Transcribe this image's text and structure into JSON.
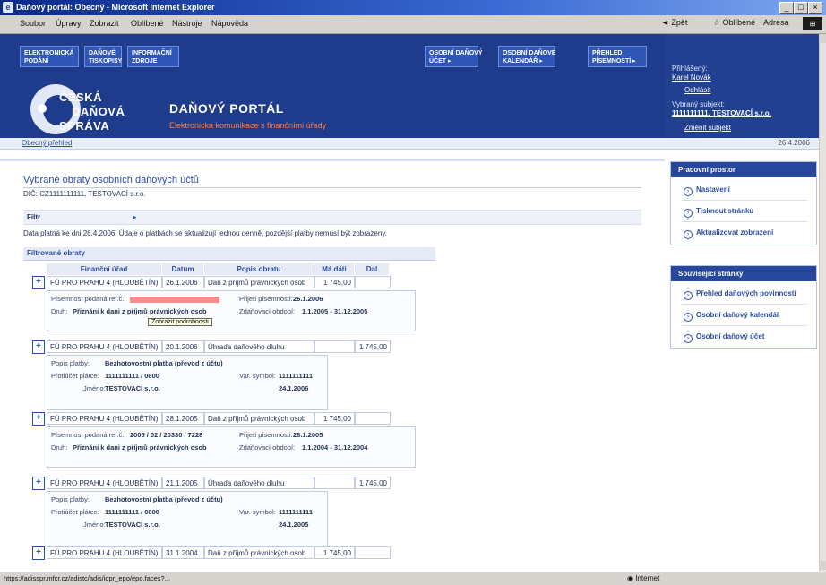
{
  "window": {
    "title": "Daňový portál: Obecný - Microsoft Internet Explorer",
    "controls": [
      "_",
      "□",
      "×"
    ]
  },
  "menubar": {
    "items": [
      "Soubor",
      "Úpravy",
      "Zobrazit",
      "Oblíbené",
      "Nástroje",
      "Nápověda"
    ],
    "toolbar_back": "Zpět",
    "toolbar_fav": "Oblíbené",
    "toolbar_address": "Adresa"
  },
  "header": {
    "top_buttons_left": [
      {
        "line1": "ELEKTRONICKÁ",
        "line2": "PODÁNÍ"
      },
      {
        "line1": "DAŇOVÉ",
        "line2": "TISKOPISY"
      },
      {
        "line1": "INFORMAČNÍ",
        "line2": "ZDROJE"
      }
    ],
    "top_buttons_right": [
      {
        "line1": "OSOBNÍ DAŇOVÝ",
        "line2": "ÚČET ▸"
      },
      {
        "line1": "OSOBNÍ DAŇOVÉ",
        "line2": "KALENDÁŘ ▸"
      },
      {
        "line1": "PŘEHLED",
        "line2": "PÍSEMNOSTÍ ▸"
      }
    ],
    "logo_lines": [
      "ČESKÁ",
      "DAŇOVÁ",
      "SPRÁVA"
    ],
    "portal_title": "DAŇOVÝ PORTÁL",
    "portal_subtitle": "Elektronická komunikace s finančními úřady",
    "right": {
      "user_label": "Přihlášený:",
      "user_name": "Karel Novák",
      "logout": "Odhlásit",
      "subject_label": "Vybraný subjekt:",
      "subject_value": "1111111111, TESTOVACÍ s.r.o.",
      "change": "Změnit subjekt"
    }
  },
  "subbar": {
    "link": "Obecný přehled",
    "date": "26.4.2006"
  },
  "main": {
    "title": "Vybrané obraty osobních daňových účtů",
    "dic": "DIČ: CZ1111111111, TESTOVACÍ s.r.o.",
    "filter_label": "Filtr",
    "filter_arrow": "▸",
    "data_line": "Data platná ke dni 26.4.2006. Údaje o platbách se aktualizují jednou denně, pozdější platby nemusí být zobrazeny.",
    "section_title": "Filtrované obraty",
    "columns": [
      "Finanční úřad",
      "Datum",
      "Popis obratu",
      "Má dáti",
      "Dal"
    ],
    "tooltip": "Zobrazit podrobnosti",
    "rows": [
      {
        "plus": "+",
        "office": "FÚ PRO PRAHU 4 (HLOUBĚTÍN)",
        "date": "26.1.2006",
        "desc": "Daň z příjmů právnických osob",
        "debit": "1 745,00",
        "credit": "",
        "detail_type": "A",
        "d_l1": "Písemnost podaná ref.č.:",
        "d_v1": "",
        "d_l2": "Druh:",
        "d_v2": "Přiznání k dani z příjmů právnických osob",
        "d_l3": "Přijetí písemnosti:",
        "d_v3": "26.1.2006",
        "d_l4": "Zdaňovací období:",
        "d_v4": "1.1.2005 - 31.12.2005"
      },
      {
        "plus": "+",
        "office": "FÚ PRO PRAHU 4 (HLOUBĚTÍN)",
        "date": "20.1.2006",
        "desc": "Úhrada daňového dluhu",
        "debit": "",
        "credit": "1 745,00",
        "detail_type": "B",
        "d_l1": "Popis platby:",
        "d_v1": "Bezhotovostní platba (převod z účtu)",
        "d_l2": "Protiúčet plátce:",
        "d_v2": "1111111111 / 0800",
        "d_l3": "Var. symbol:",
        "d_v3": "1111111111",
        "d_l4": "Jméno:",
        "d_v4": "TESTOVACÍ s.r.o.",
        "d_l5": "",
        "d_v5": "24.1.2006"
      },
      {
        "plus": "+",
        "office": "FÚ PRO PRAHU 4 (HLOUBĚTÍN)",
        "date": "28.1.2005",
        "desc": "Daň z příjmů právnických osob",
        "debit": "1 745,00",
        "credit": "",
        "detail_type": "A",
        "d_l1": "Písemnost podaná ref.č.:",
        "d_v1": "2005 / 02 / 20330 / 7228",
        "d_l2": "Druh:",
        "d_v2": "Přiznání k dani z příjmů právnických osob",
        "d_l3": "Přijetí písemnosti:",
        "d_v3": "28.1.2005",
        "d_l4": "Zdaňovací období:",
        "d_v4": "1.1.2004 - 31.12.2004"
      },
      {
        "plus": "+",
        "office": "FÚ PRO PRAHU 4 (HLOUBĚTÍN)",
        "date": "21.1.2005",
        "desc": "Úhrada daňového dluhu",
        "debit": "",
        "credit": "1 745,00",
        "detail_type": "B",
        "d_l1": "Popis platby:",
        "d_v1": "Bezhotovostní platba (převod z účtu)",
        "d_l2": "Protiúčet plátce:",
        "d_v2": "1111111111 / 0800",
        "d_l3": "Var. symbol:",
        "d_v3": "1111111111",
        "d_l4": "Jméno:",
        "d_v4": "TESTOVACÍ s.r.o.",
        "d_l5": "",
        "d_v5": "24.1.2005"
      },
      {
        "plus": "+",
        "office": "FÚ PRO PRAHU 4 (HLOUBĚTÍN)",
        "date": "31.1.2004",
        "desc": "Daň z příjmů právnických osob",
        "debit": "1 745,00",
        "credit": "",
        "detail_type": "none"
      }
    ]
  },
  "sidebar": {
    "panel1_title": "Pracovní prostor",
    "panel1_items": [
      "Nastavení",
      "Tisknout stránku",
      "Aktualizovat zobrazení"
    ],
    "panel2_title": "Související stránky",
    "panel2_items": [
      "Přehled daňových povinností",
      "Osobní daňový kalendář",
      "Osobní daňový účet"
    ]
  },
  "statusbar": {
    "text": "https://adisspr.mfcr.cz/adistc/adis/idpr_epo/epo.faces?...",
    "zone": "Internet"
  },
  "colors": {
    "header_bg": "#1f3c8c",
    "accent": "#2a4da6",
    "orange": "#ff7a3c"
  }
}
